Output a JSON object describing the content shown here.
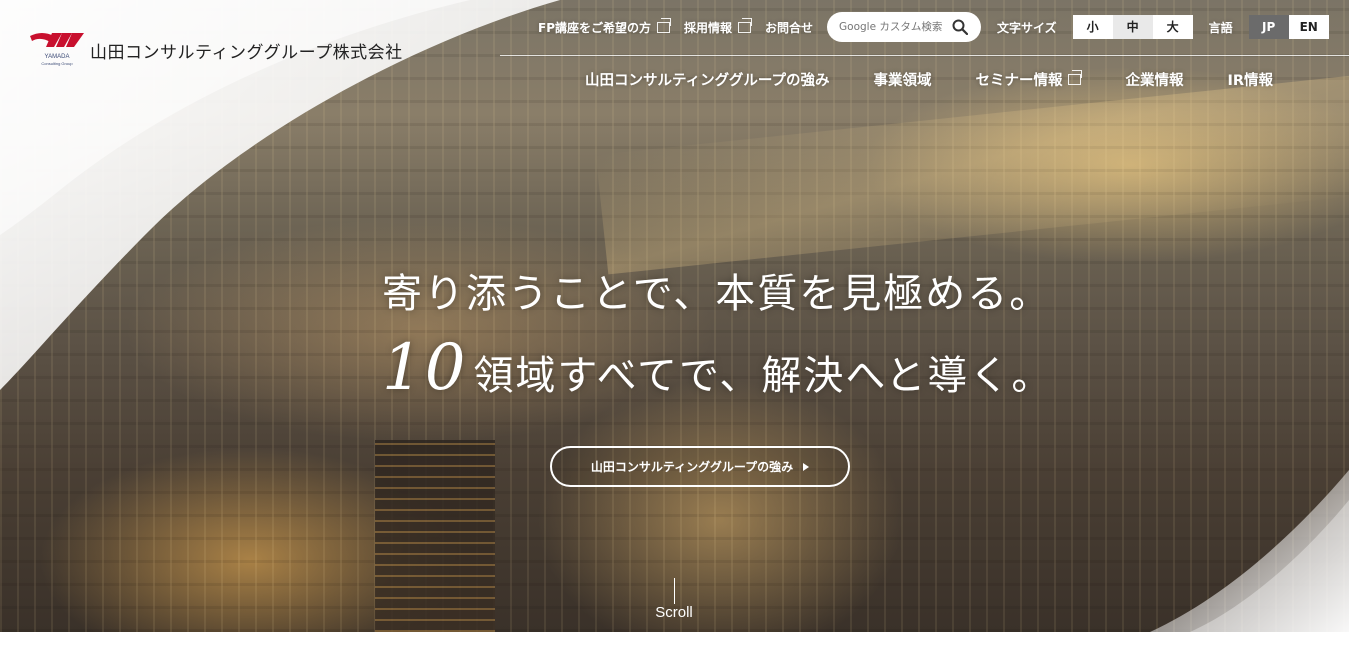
{
  "brand": {
    "company_name": "山田コンサルティンググループ株式会社",
    "logo_text": "YAMADA",
    "logo_subtext": "Consulting Group",
    "colors": {
      "logo_red": "#c8102e",
      "logo_text": "#3b4a75"
    }
  },
  "utility": {
    "links": [
      {
        "label": "FP講座をご希望の方",
        "icon": "external-window-icon"
      },
      {
        "label": "採用情報",
        "icon": "external-window-icon"
      },
      {
        "label": "お問合せ"
      }
    ],
    "search": {
      "placeholder": "Google カスタム検索",
      "icon": "search-icon"
    },
    "font_size": {
      "label": "文字サイズ",
      "options": [
        "小",
        "中",
        "大"
      ],
      "selected": "中"
    },
    "language": {
      "label": "言語",
      "options": [
        "JP",
        "EN"
      ],
      "selected": "JP"
    }
  },
  "nav": {
    "items": [
      {
        "label": "山田コンサルティンググループの強み"
      },
      {
        "label": "事業領域"
      },
      {
        "label": "セミナー情報",
        "icon": "external-window-icon"
      },
      {
        "label": "企業情報"
      },
      {
        "label": "IR情報"
      }
    ]
  },
  "hero": {
    "headline_line1": "寄り添うことで、本質を見極める。",
    "headline_number": "10",
    "headline_line2": "領域すべてで、解決へと導く。",
    "cta_label": "山田コンサルティンググループの強み",
    "scroll_label": "Scroll"
  }
}
